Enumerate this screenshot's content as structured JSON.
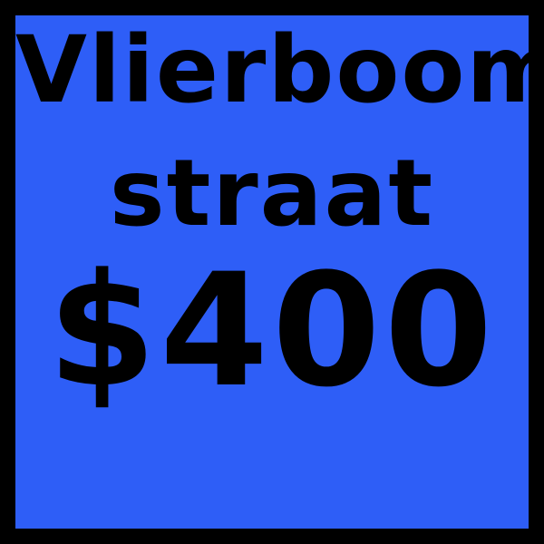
{
  "card": {
    "name_line_1": "Vlierboom-",
    "name_line_2": "straat",
    "price": "$400"
  },
  "colors": {
    "card_background": "#2e5ef7",
    "border": "#000000",
    "text": "#000000"
  }
}
